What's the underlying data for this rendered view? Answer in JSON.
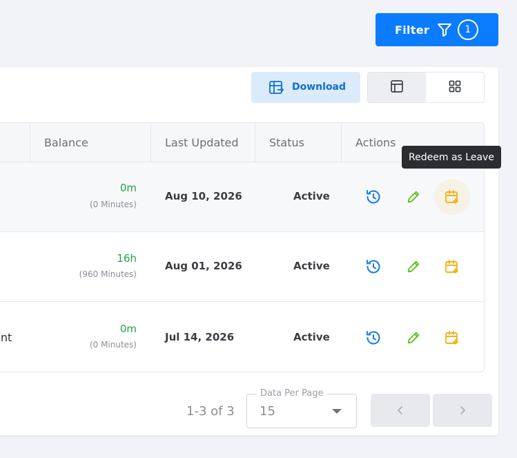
{
  "toolbar": {
    "filter_label": "Filter",
    "filter_count": "1",
    "download_label": "Download"
  },
  "table": {
    "columns": [
      "Balance",
      "Last Updated",
      "Status",
      "Actions"
    ],
    "rows": [
      {
        "name_fragment": "",
        "balance": "0m",
        "balance_minutes": "(0 Minutes)",
        "last_updated": "Aug 10, 2026",
        "status": "Active"
      },
      {
        "name_fragment": "",
        "balance": "16h",
        "balance_minutes": "(960 Minutes)",
        "last_updated": "Aug 01, 2026",
        "status": "Active"
      },
      {
        "name_fragment": "ent",
        "balance": "0m",
        "balance_minutes": "(0 Minutes)",
        "last_updated": "Jul 14, 2026",
        "status": "Active"
      }
    ]
  },
  "tooltip": "Redeem as Leave",
  "pagination": {
    "range": "1-3 of 3",
    "per_page_label": "Data Per Page",
    "per_page_value": "15"
  },
  "colors": {
    "primary": "#0b7bff",
    "history": "#1c7ee6",
    "edit": "#5cc21d",
    "redeem": "#f5b21a",
    "balance": "#25a244"
  },
  "icons": [
    "filter-icon",
    "download-icon",
    "table-view-icon",
    "grid-view-icon",
    "history-icon",
    "edit-icon",
    "redeem-icon",
    "chevron-left-icon",
    "chevron-right-icon"
  ]
}
